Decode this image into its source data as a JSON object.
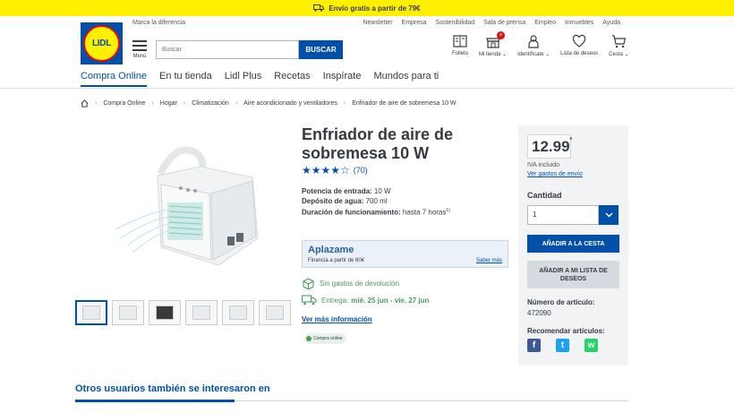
{
  "promo": {
    "text": "Envío gratis a partir de 79€"
  },
  "logo": {
    "text": "LIDL"
  },
  "header": {
    "tagline": "Marca la diferencia",
    "toplinks": [
      "Newsletter",
      "Empresa",
      "Sostenibilidad",
      "Sala de prensa",
      "Empleo",
      "Inmuebles",
      "Ayuda"
    ],
    "menu_label": "Menú",
    "search_placeholder": "Buscar",
    "search_button": "BUSCAR",
    "icons": {
      "folleto": "Folleto",
      "mi_tienda": "Mi tienda",
      "identificate": "Identifícate",
      "lista": "Lista de deseos",
      "cesta": "Cesta"
    }
  },
  "nav": [
    "Compra Online",
    "En tu tienda",
    "Lidl Plus",
    "Recetas",
    "Inspírate",
    "Mundos para ti"
  ],
  "breadcrumb": [
    "Compra Online",
    "Hogar",
    "Climatización",
    "Aire acondicionado y ventiladores",
    "Enfriador de aire de sobremesa 10 W"
  ],
  "product": {
    "title": "Enfriador de aire de sobremesa 10 W",
    "stars": "★★★★☆",
    "rating_count": "(70)",
    "specs": [
      {
        "label": "Potencia de entrada:",
        "value": "10 W"
      },
      {
        "label": "Depósito de agua:",
        "value": "700 ml"
      },
      {
        "label": "Duración de funcionamiento:",
        "value": "hasta 7 horas",
        "sup": "1)"
      }
    ],
    "aplazame": {
      "brand": "Aplazame",
      "financing": "Financia a partir de 60€",
      "more": "Saber más"
    },
    "returns": "Sin gastos de devolución",
    "delivery_label": "Entrega:",
    "delivery_dates": "mié. 25 jun - vie. 27 jun",
    "more_info": "Ver más información",
    "online_badge": "Compra online"
  },
  "buybox": {
    "price": "12.99",
    "price_sup": "*",
    "iva": "IVA incluido",
    "shipping_link": "Ver gastos de envío",
    "qty_label": "Cantidad",
    "qty_value": "1",
    "add_cart": "AÑADIR A LA CESTA",
    "add_wish": "AÑADIR A MI LISTA DE DESEOS",
    "article_label": "Número de artículo:",
    "article_number": "472090",
    "recommend_label": "Recomendar artículos:"
  },
  "others_title": "Otros usuarios también se interesaron en",
  "colors": {
    "lidl_blue": "#0050aa",
    "lidl_yellow": "#fff000",
    "lidl_red": "#e60a14",
    "green": "#4c9b5a"
  }
}
